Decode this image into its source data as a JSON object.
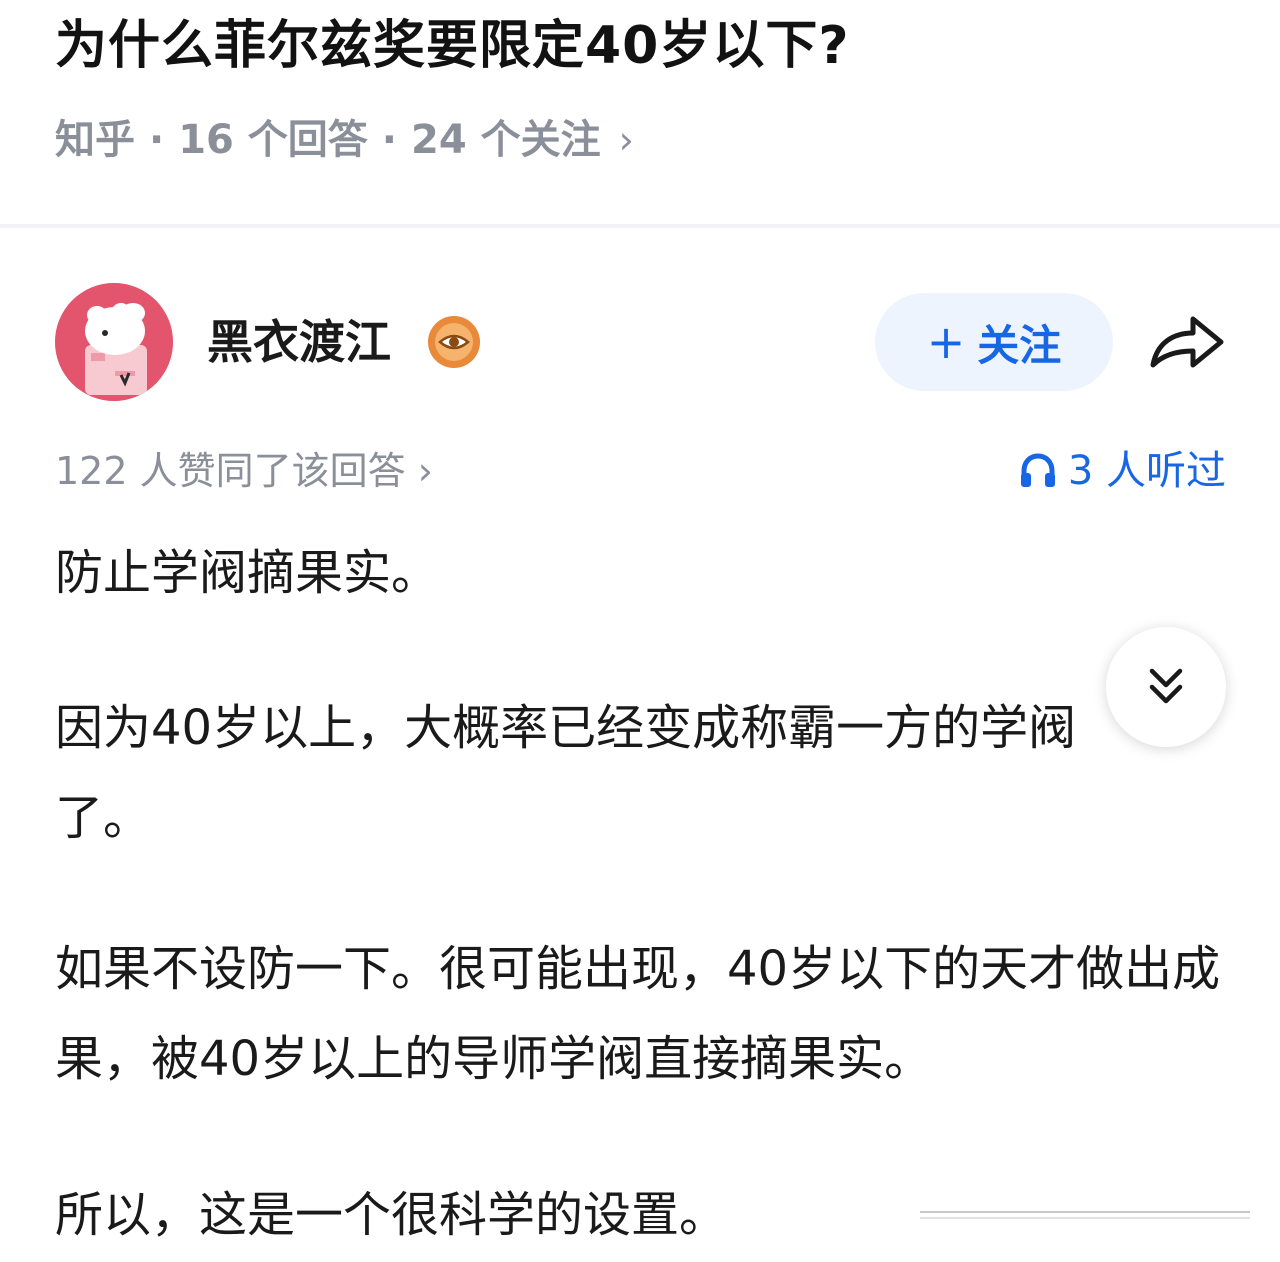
{
  "question": {
    "title": "为什么菲尔兹奖要限定40岁以下?",
    "source": "知乎",
    "separator": "·",
    "answers": "16 个回答",
    "followers": "24 个关注",
    "chevron": "›"
  },
  "author": {
    "name": "黑衣渡江",
    "badge_icon": "eye-badge-icon",
    "follow_plus": "+",
    "follow_label": "关注",
    "share_icon": "share-arrow-icon"
  },
  "stats": {
    "votes": "122 人赞同了该回答",
    "votes_chevron": "›",
    "listens": "3 人听过",
    "listen_icon": "headphones-icon"
  },
  "answer": {
    "paragraphs": [
      "防止学阀摘果实。",
      "因为40岁以上，大概率已经变成称霸一方的学阀了。",
      "如果不设防一下。很可能出现，40岁以下的天才做出成果，被40岁以上的导师学阀直接摘果实。",
      "所以，这是一个很科学的设置。"
    ]
  },
  "colors": {
    "accent": "#1766e5",
    "meta": "#8a8f99",
    "follow_bg": "#eef4fd",
    "avatar_bg": "#e2556d",
    "badge": "#e98a3a"
  }
}
